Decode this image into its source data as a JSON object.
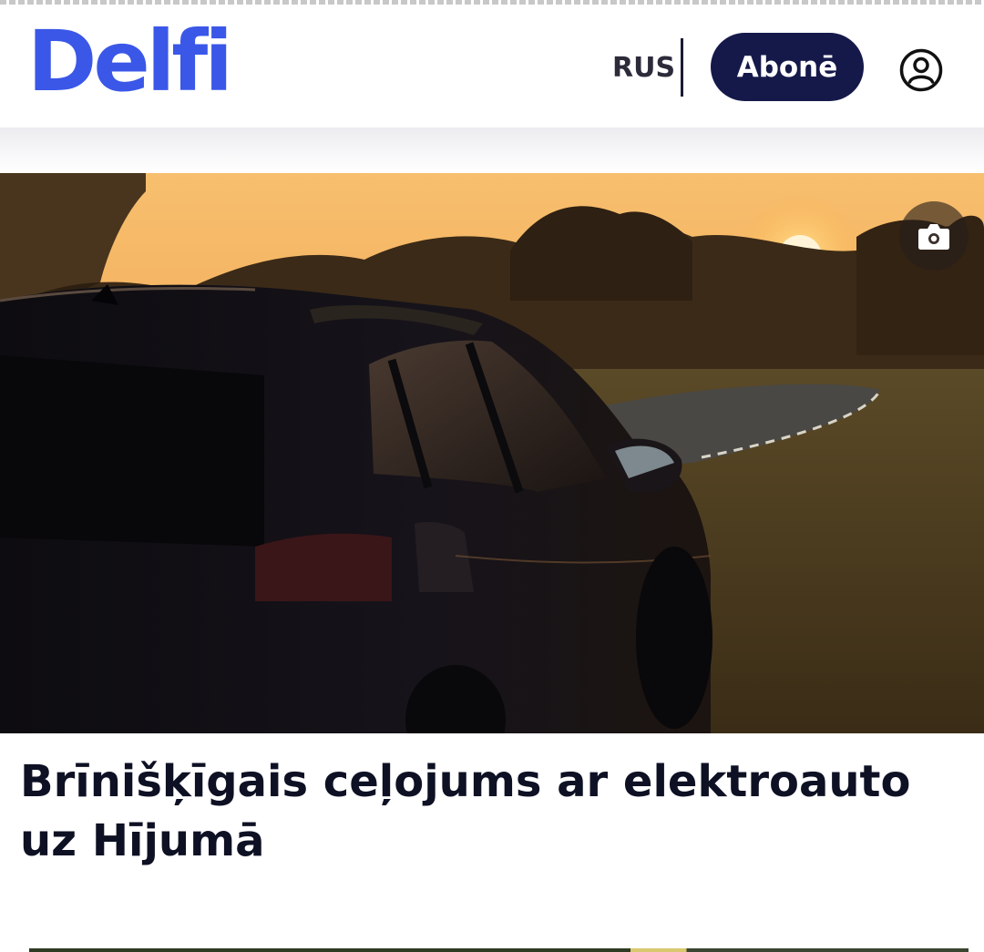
{
  "header": {
    "logo_text": "Delfi",
    "language_label": "RUS",
    "subscribe_label": "Abonē",
    "account_icon": "user-circle-icon"
  },
  "article": {
    "photo_description": "black electric SUV parked on roadside at sunset",
    "gallery_icon": "camera-icon",
    "title": "Brīnišķīgais ceļojums ar elektroauto uz Hījumā"
  },
  "colors": {
    "brand_blue": "#3a57e8",
    "subscribe_bg": "#15194a",
    "title_text": "#0e1124"
  }
}
